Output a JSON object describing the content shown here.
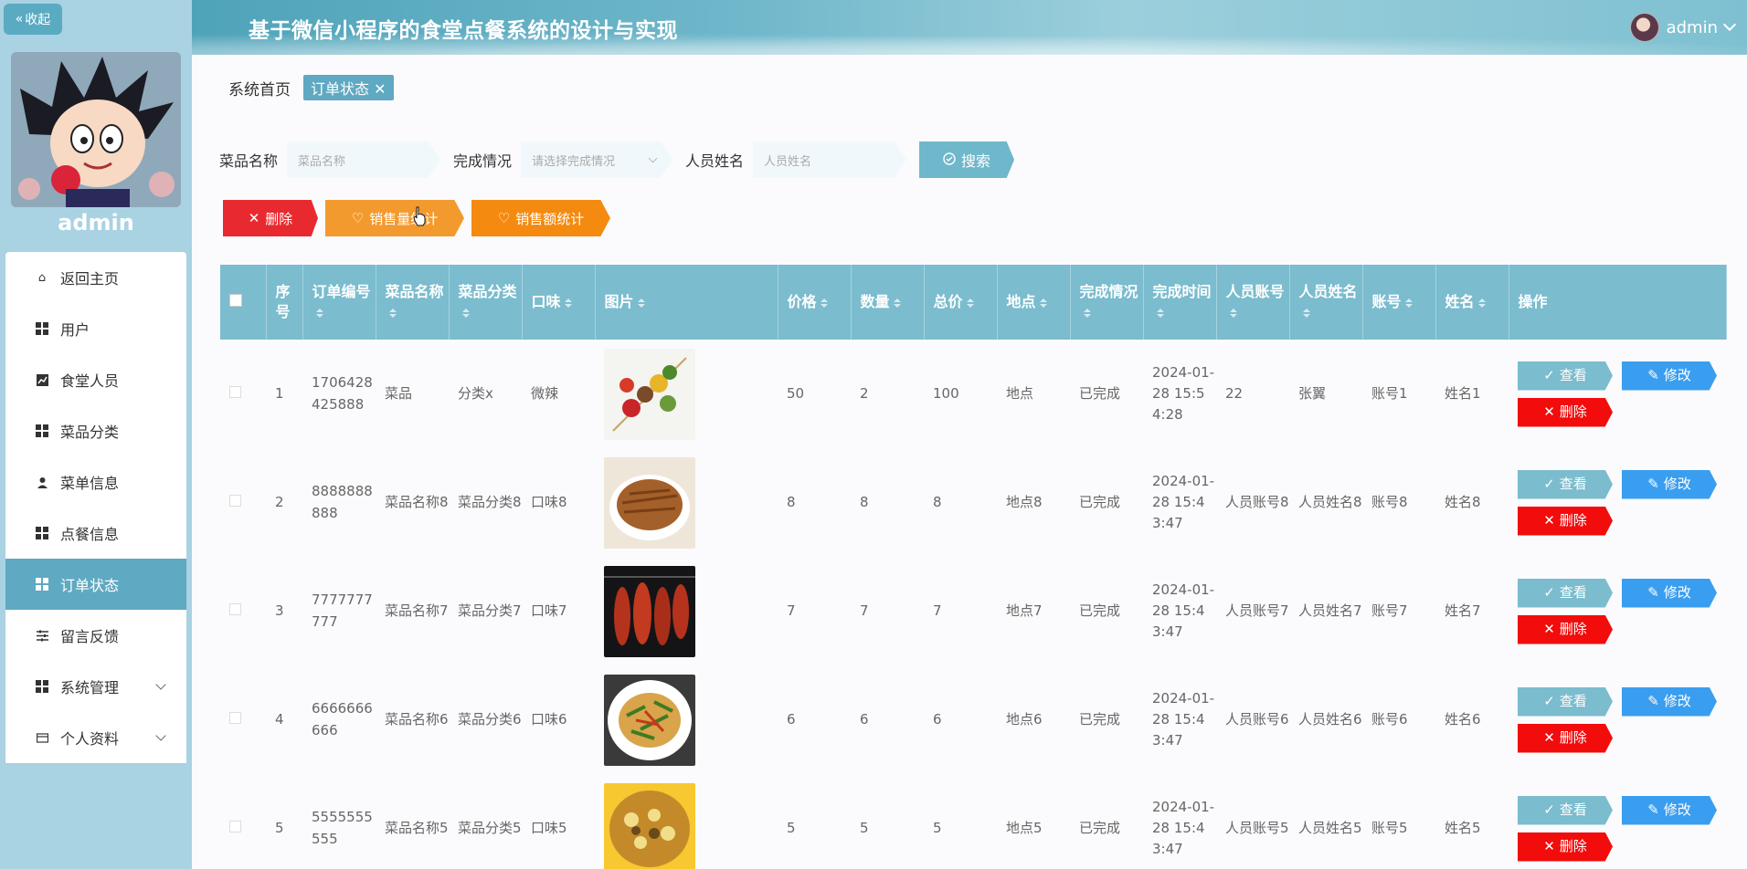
{
  "header": {
    "title": "基于微信小程序的食堂点餐系统的设计与实现",
    "username": "admin"
  },
  "sidebar": {
    "collapse_label": "收起",
    "profile_name": "admin",
    "items": [
      {
        "label": "返回主页",
        "icon": "home-icon"
      },
      {
        "label": "用户",
        "icon": "grid-icon"
      },
      {
        "label": "食堂人员",
        "icon": "chart-icon"
      },
      {
        "label": "菜品分类",
        "icon": "grid-icon"
      },
      {
        "label": "菜单信息",
        "icon": "person-icon"
      },
      {
        "label": "点餐信息",
        "icon": "grid-icon"
      },
      {
        "label": "订单状态",
        "icon": "grid-icon",
        "active": true
      },
      {
        "label": "留言反馈",
        "icon": "sliders-icon"
      },
      {
        "label": "系统管理",
        "icon": "grid-icon",
        "expandable": true
      },
      {
        "label": "个人资料",
        "icon": "card-icon",
        "expandable": true
      }
    ]
  },
  "breadcrumb": {
    "home": "系统首页",
    "current": "订单状态"
  },
  "search": {
    "dish_label": "菜品名称",
    "dish_placeholder": "菜品名称",
    "status_label": "完成情况",
    "status_placeholder": "请选择完成情况",
    "person_label": "人员姓名",
    "person_placeholder": "人员姓名",
    "button": "搜索"
  },
  "actions": {
    "delete": "删除",
    "sales_count": "销售量统计",
    "sales_amount": "销售额统计"
  },
  "table": {
    "headers": [
      "序号",
      "订单编号",
      "菜品名称",
      "菜品分类",
      "口味",
      "图片",
      "价格",
      "数量",
      "总价",
      "地点",
      "完成情况",
      "完成时间",
      "人员账号",
      "人员姓名",
      "账号",
      "姓名",
      "操作"
    ],
    "rows": [
      [
        "1",
        "1706428425888",
        "菜品",
        "分类x",
        "微辣",
        "",
        "50",
        "2",
        "100",
        "地点",
        "已完成",
        "2024-01-28 15:54:28",
        "22",
        "张翼",
        "账号1",
        "姓名1"
      ],
      [
        "2",
        "8888888888",
        "菜品名称8",
        "菜品分类8",
        "口味8",
        "",
        "8",
        "8",
        "8",
        "地点8",
        "已完成",
        "2024-01-28 15:43:47",
        "人员账号8",
        "人员姓名8",
        "账号8",
        "姓名8"
      ],
      [
        "3",
        "7777777777",
        "菜品名称7",
        "菜品分类7",
        "口味7",
        "",
        "7",
        "7",
        "7",
        "地点7",
        "已完成",
        "2024-01-28 15:43:47",
        "人员账号7",
        "人员姓名7",
        "账号7",
        "姓名7"
      ],
      [
        "4",
        "6666666666",
        "菜品名称6",
        "菜品分类6",
        "口味6",
        "",
        "6",
        "6",
        "6",
        "地点6",
        "已完成",
        "2024-01-28 15:43:47",
        "人员账号6",
        "人员姓名6",
        "账号6",
        "姓名6"
      ],
      [
        "5",
        "5555555555",
        "菜品名称5",
        "菜品分类5",
        "口味5",
        "",
        "5",
        "5",
        "5",
        "地点5",
        "已完成",
        "2024-01-28 15:43:47",
        "人员账号5",
        "人员姓名5",
        "账号5",
        "姓名5"
      ]
    ],
    "ops": {
      "view": "查看",
      "edit": "修改",
      "delete": "删除"
    }
  },
  "colors": {
    "accent": "#5fa9c2",
    "header_row": "#7bbcce",
    "danger": "#f20c0c",
    "edit": "#3a9ef0",
    "orange": "#f39a2f"
  }
}
